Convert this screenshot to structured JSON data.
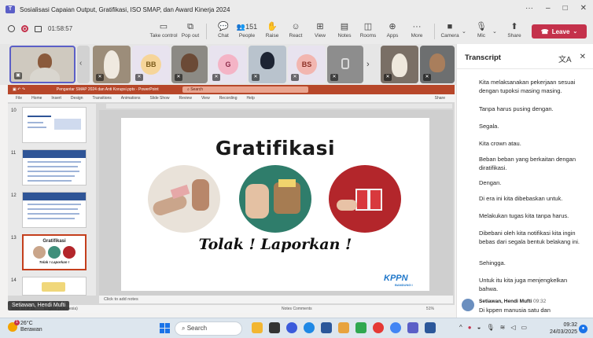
{
  "window": {
    "title": "Sosialisasi Capaian Output, Gratifikasi, ISO SMAP, dan Award Kinerja 2024",
    "controls": [
      "···",
      "–",
      "□",
      "✕"
    ]
  },
  "meeting": {
    "timer": "01:58:57",
    "participant_count": "151",
    "buttons": [
      {
        "label": "Take control",
        "icon": "▭"
      },
      {
        "label": "Pop out",
        "icon": "⧉"
      },
      {
        "label": "Chat",
        "icon": "💬"
      },
      {
        "label": "People",
        "icon": "👥"
      },
      {
        "label": "Raise",
        "icon": "✋"
      },
      {
        "label": "React",
        "icon": "☺"
      },
      {
        "label": "View",
        "icon": "⊞"
      },
      {
        "label": "Notes",
        "icon": "▤"
      },
      {
        "label": "Rooms",
        "icon": "◫"
      },
      {
        "label": "Apps",
        "icon": "⊕"
      },
      {
        "label": "More",
        "icon": "···"
      },
      {
        "label": "Camera",
        "icon": "■"
      },
      {
        "label": "Mic",
        "icon": "🎙"
      },
      {
        "label": "Share",
        "icon": "⬆"
      }
    ],
    "leave_label": "Leave"
  },
  "gallery": {
    "tiles": [
      {
        "initials": "",
        "name": "speaker-video"
      },
      {
        "initials": "",
        "name": "video-2"
      },
      {
        "initials": "BB",
        "name": "bb"
      },
      {
        "initials": "",
        "name": "video-4"
      },
      {
        "initials": "G",
        "name": "g"
      },
      {
        "initials": "",
        "name": "video-6"
      },
      {
        "initials": "BS",
        "name": "bs"
      },
      {
        "initials": "",
        "name": "video-8"
      },
      {
        "initials": "",
        "name": "video-9"
      }
    ]
  },
  "powerpoint": {
    "file_title": "Pengantar SMAP 2024 dan Anti Korupsi.pptx - PowerPoint",
    "search_placeholder": "Search",
    "menu": [
      "File",
      "Home",
      "Insert",
      "Design",
      "Transitions",
      "Animations",
      "Slide Show",
      "Review",
      "View",
      "Recording",
      "Help"
    ],
    "share_label": "Share",
    "thumb_numbers": [
      "10",
      "11",
      "12",
      "13",
      "14"
    ],
    "notes_placeholder": "Click to add notes",
    "status_left": "Slide 13 of 19",
    "status_lang": "English (Indonesia)",
    "status_right": "Notes   Comments",
    "zoom": "51%"
  },
  "slide": {
    "title": "Gratifikasi",
    "subtitle": "Tolak ! Laporkan !",
    "logo": "KPPN",
    "logo_sub": "BANDUNG I"
  },
  "name_tag": "Setiawan, Hendi Mufti",
  "transcript": {
    "title": "Transcript",
    "lines": [
      "Kita melaksanakan pekerjaan sesuai dengan tupoksi masing masing.",
      "Tanpa harus pusing dengan.",
      "Segala.",
      "Kita crown atau.",
      "Beban beban yang berkaitan dengan diratifikasi.",
      "Dengan.",
      "Di era ini kita dibebaskan untuk.",
      "Melakukan tugas kita tanpa harus.",
      "Dibebani oleh kita notifikasi kita ingin bebas dari segala bentuk belakang ini.",
      "Sehingga.",
      "Untuk itu kita juga menjengkelkan bahwa."
    ],
    "speaker": {
      "name": "Setiawan, Hendi Mufti",
      "time": "09:32"
    },
    "last_line": "Di kppen manusia satu dan"
  },
  "taskbar": {
    "weather_temp": "26°C",
    "weather_desc": "Berawan",
    "search_placeholder": "Search",
    "clock_time": "09:32",
    "clock_date": "24/03/2025"
  }
}
